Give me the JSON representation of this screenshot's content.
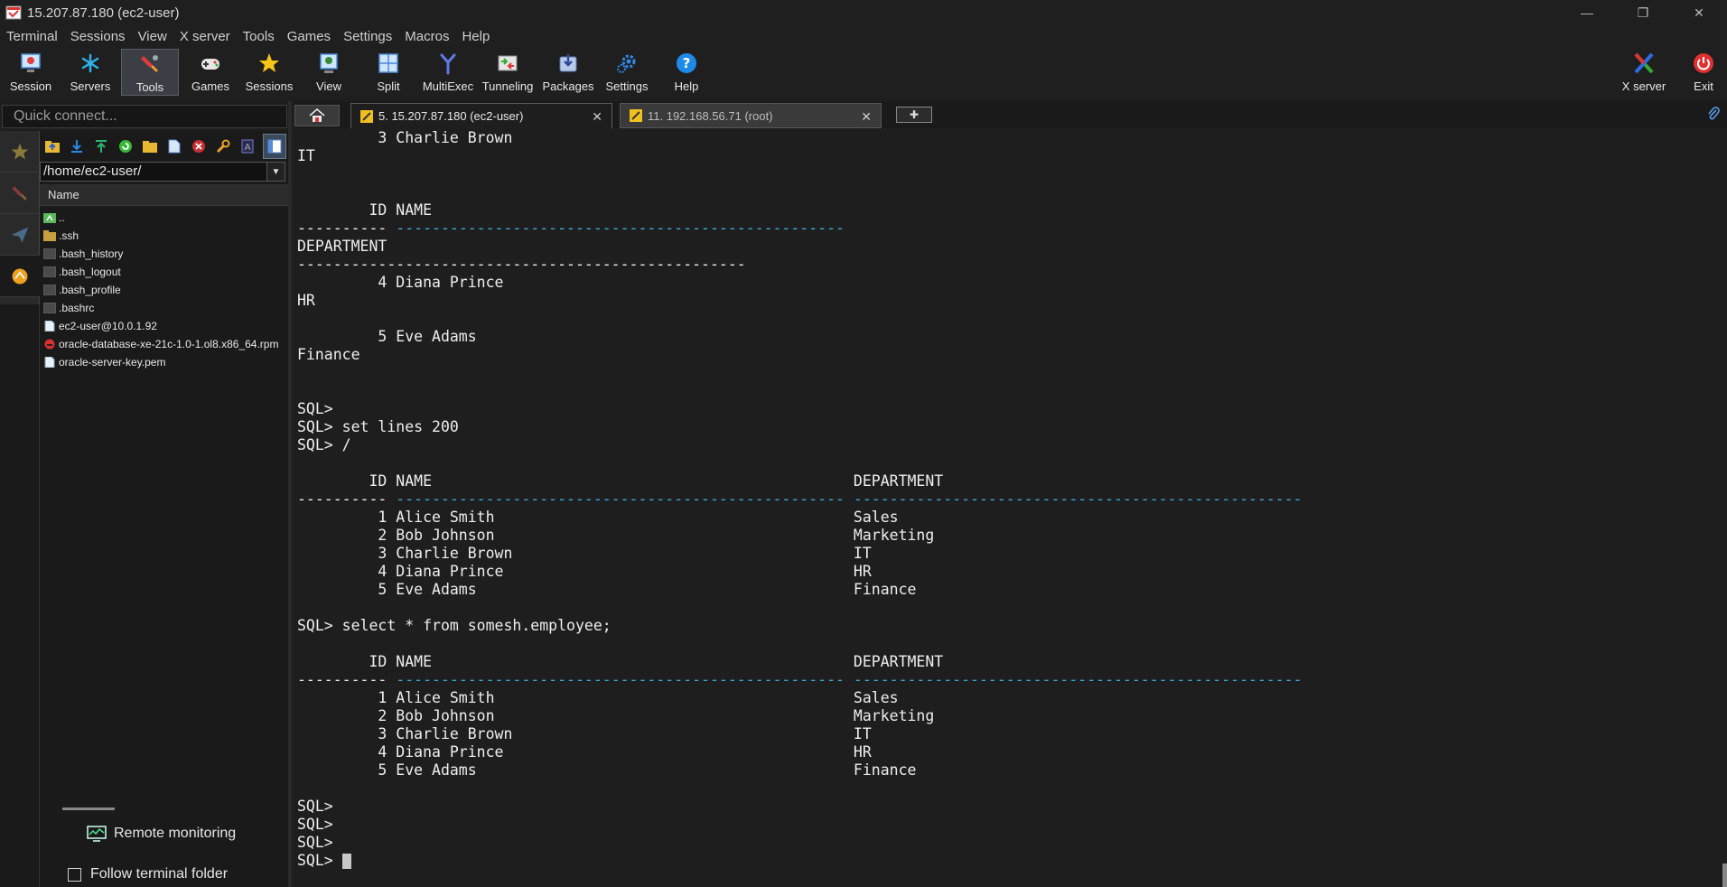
{
  "window": {
    "title": "15.207.87.180 (ec2-user)"
  },
  "menu": [
    "Terminal",
    "Sessions",
    "View",
    "X server",
    "Tools",
    "Games",
    "Settings",
    "Macros",
    "Help"
  ],
  "toolbar": {
    "session": "Session",
    "servers": "Servers",
    "tools": "Tools",
    "games": "Games",
    "sessions": "Sessions",
    "view": "View",
    "split": "Split",
    "multiexec": "MultiExec",
    "tunneling": "Tunneling",
    "packages": "Packages",
    "settings": "Settings",
    "help": "Help",
    "xserver": "X server",
    "exit": "Exit"
  },
  "quick_connect": {
    "placeholder": "Quick connect..."
  },
  "file_browser": {
    "path": "/home/ec2-user/",
    "column": "Name",
    "files": [
      {
        "name": "..",
        "type": "up"
      },
      {
        "name": ".ssh",
        "type": "folder"
      },
      {
        "name": ".bash_history",
        "type": "file-dark"
      },
      {
        "name": ".bash_logout",
        "type": "file-dark"
      },
      {
        "name": ".bash_profile",
        "type": "file-dark"
      },
      {
        "name": ".bashrc",
        "type": "file-dark"
      },
      {
        "name": "ec2-user@10.0.1.92",
        "type": "file-white"
      },
      {
        "name": "oracle-database-xe-21c-1.0-1.ol8.x86_64.rpm",
        "type": "rpm"
      },
      {
        "name": "oracle-server-key.pem",
        "type": "file-white"
      }
    ],
    "remote_monitoring": "Remote monitoring",
    "follow_folder": "Follow terminal folder"
  },
  "tabs": [
    {
      "label": "5. 15.207.87.180 (ec2-user)",
      "active": true
    },
    {
      "label": "11. 192.168.56.71 (root)",
      "active": false
    }
  ],
  "terminal": {
    "lines": [
      {
        "text": "         3 Charlie Brown"
      },
      {
        "text": "IT"
      },
      {
        "text": ""
      },
      {
        "text": ""
      },
      {
        "text": "        ID NAME"
      },
      {
        "parts": [
          "----------",
          " ",
          "--------------------------------------------------"
        ]
      },
      {
        "text": "DEPARTMENT"
      },
      {
        "text": "--------------------------------------------------"
      },
      {
        "text": "         4 Diana Prince"
      },
      {
        "text": "HR"
      },
      {
        "text": ""
      },
      {
        "text": "         5 Eve Adams"
      },
      {
        "text": "Finance"
      },
      {
        "text": ""
      },
      {
        "text": ""
      },
      {
        "text": "SQL>"
      },
      {
        "text": "SQL> set lines 200"
      },
      {
        "text": "SQL> /"
      },
      {
        "text": ""
      },
      {
        "text": "        ID NAME                                               DEPARTMENT"
      },
      {
        "parts": [
          "----------",
          " ",
          "--------------------------------------------------",
          " ",
          "--------------------------------------------------"
        ]
      },
      {
        "text": "         1 Alice Smith                                        Sales"
      },
      {
        "text": "         2 Bob Johnson                                        Marketing"
      },
      {
        "text": "         3 Charlie Brown                                      IT"
      },
      {
        "text": "         4 Diana Prince                                       HR"
      },
      {
        "text": "         5 Eve Adams                                          Finance"
      },
      {
        "text": ""
      },
      {
        "text": "SQL> select * from somesh.employee;"
      },
      {
        "text": ""
      },
      {
        "text": "        ID NAME                                               DEPARTMENT"
      },
      {
        "parts": [
          "----------",
          " ",
          "--------------------------------------------------",
          " ",
          "--------------------------------------------------"
        ]
      },
      {
        "text": "         1 Alice Smith                                        Sales"
      },
      {
        "text": "         2 Bob Johnson                                        Marketing"
      },
      {
        "text": "         3 Charlie Brown                                      IT"
      },
      {
        "text": "         4 Diana Prince                                       HR"
      },
      {
        "text": "         5 Eve Adams                                          Finance"
      },
      {
        "text": ""
      },
      {
        "text": "SQL>"
      },
      {
        "text": "SQL>"
      },
      {
        "text": "SQL>"
      },
      {
        "text": "SQL> ",
        "cursor": true
      }
    ]
  }
}
